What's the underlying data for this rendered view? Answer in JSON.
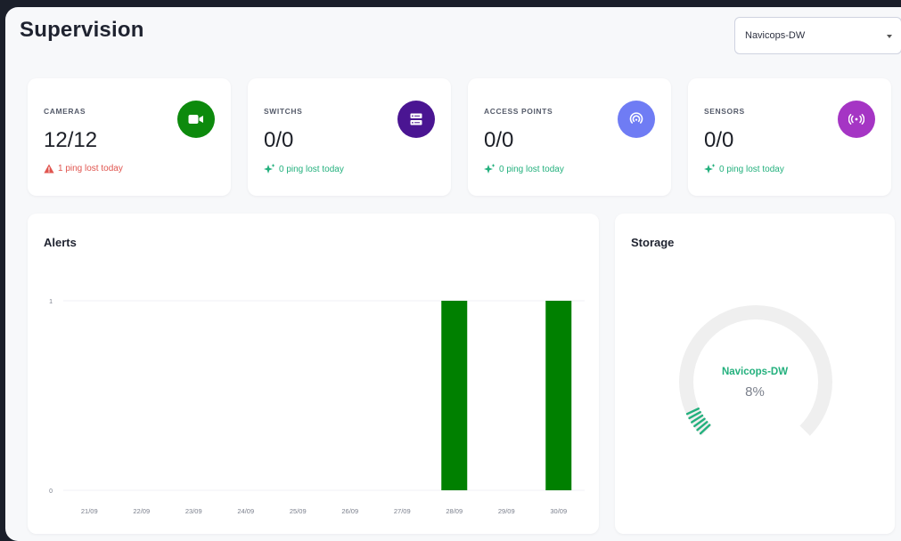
{
  "page": {
    "title": "Supervision"
  },
  "site_select": {
    "value": "Navicops-DW"
  },
  "stats": [
    {
      "label": "CAMERAS",
      "value": "12/12",
      "note": "1 ping lost today",
      "status": "warning",
      "icon": "video-camera-icon",
      "color": "#0d8a0d"
    },
    {
      "label": "SWITCHS",
      "value": "0/0",
      "note": "0 ping lost today",
      "status": "ok",
      "icon": "server-switch-icon",
      "color": "#4a1592"
    },
    {
      "label": "ACCESS POINTS",
      "value": "0/0",
      "note": "0 ping lost today",
      "status": "ok",
      "icon": "wifi-access-point-icon",
      "color": "#6f7cf4"
    },
    {
      "label": "SENSORS",
      "value": "0/0",
      "note": "0 ping lost today",
      "status": "ok",
      "icon": "broadcast-sensor-icon",
      "color": "#a535c4"
    }
  ],
  "colors": {
    "warning": "#e0554f",
    "ok": "#23b07d",
    "bar": "#008000",
    "gauge_track": "#efefef",
    "gauge_fill": "#23b07d"
  },
  "alerts": {
    "title": "Alerts",
    "chart_data": {
      "type": "bar",
      "categories": [
        "21/09",
        "22/09",
        "23/09",
        "24/09",
        "25/09",
        "26/09",
        "27/09",
        "28/09",
        "29/09",
        "30/09"
      ],
      "values": [
        0,
        0,
        0,
        0,
        0,
        0,
        0,
        1,
        0,
        1
      ],
      "yticks": [
        "0",
        "1"
      ],
      "ylim": [
        0,
        1
      ],
      "grid": true,
      "legend": "none"
    }
  },
  "storage": {
    "title": "Storage",
    "name": "Navicops-DW",
    "percent_label": "8%",
    "percent": 8
  }
}
